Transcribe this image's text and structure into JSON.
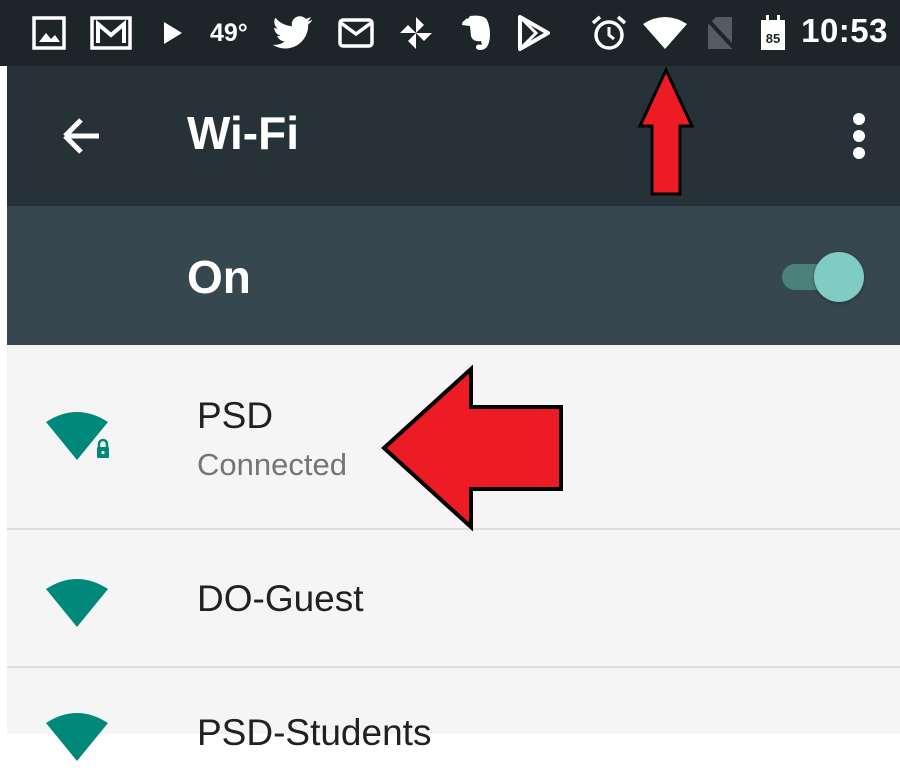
{
  "status_bar": {
    "temperature": "49°",
    "time": "10:53",
    "calendar_day": "85",
    "icons": [
      "image-icon",
      "gmail-icon",
      "play-icon",
      "twitter-icon",
      "mail-icon",
      "pinwheel-icon",
      "evernote-icon",
      "play-store-icon",
      "alarm-icon",
      "wifi-signal-icon",
      "no-sim-icon",
      "calendar-icon"
    ]
  },
  "app_bar": {
    "title": "Wi-Fi",
    "back_icon": "back-arrow-icon",
    "menu_icon": "more-vert-icon"
  },
  "master_switch": {
    "label": "On",
    "state": "on"
  },
  "networks": [
    {
      "name": "PSD",
      "status": "Connected",
      "secured": true
    },
    {
      "name": "DO-Guest",
      "status": "",
      "secured": false
    },
    {
      "name": "PSD-Students",
      "status": "",
      "secured": false
    }
  ],
  "colors": {
    "status_bar": "#1d2529",
    "app_bar": "#263238",
    "switch_bar": "#37474f",
    "accent": "#00897b",
    "toggle_thumb": "#80cbc4",
    "annotation_arrow": "#ed1c24"
  }
}
